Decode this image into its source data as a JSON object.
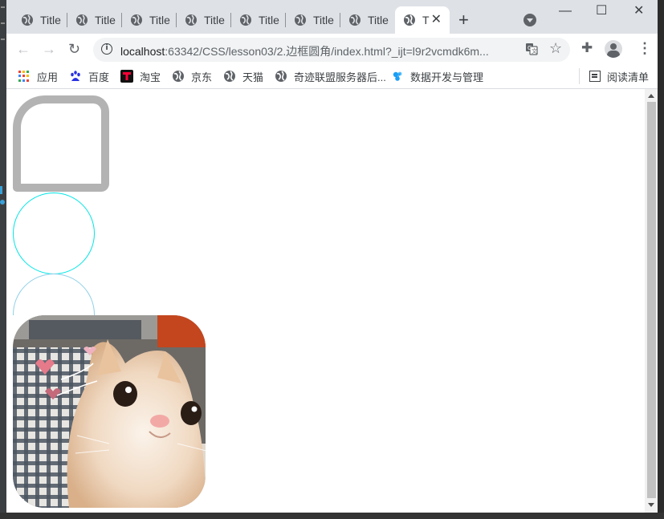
{
  "tabs": [
    {
      "label": "Title"
    },
    {
      "label": "Title"
    },
    {
      "label": "Title"
    },
    {
      "label": "Title"
    },
    {
      "label": "Title"
    },
    {
      "label": "Title"
    },
    {
      "label": "Title"
    },
    {
      "label": "T",
      "active": true
    }
  ],
  "tab_close_glyph": "✕",
  "new_tab_glyph": "+",
  "window_controls": {
    "minimize": "—",
    "maximize": "☐",
    "close": "✕"
  },
  "nav": {
    "back": "←",
    "forward": "→",
    "reload": "↻"
  },
  "omnibox": {
    "info_icon": "i",
    "url_host": "localhost",
    "url_path": ":63342/CSS/lesson03/2.边框圆角/index.html?_ijt=l9r2vcmdk6m...",
    "star": "☆"
  },
  "toolbar_icons": {
    "extensions": "✚",
    "menu": "⋮"
  },
  "bookmarks": [
    {
      "label": "应用",
      "icon": "apps-icon"
    },
    {
      "label": "百度",
      "icon": "baidu-icon"
    },
    {
      "label": "淘宝",
      "icon": "taobao-icon"
    },
    {
      "label": "京东",
      "icon": "globe-icon"
    },
    {
      "label": "天猫",
      "icon": "globe-icon"
    },
    {
      "label": "奇迹联盟服务器后...",
      "icon": "globe-icon"
    },
    {
      "label": "数据开发与管理",
      "icon": "data-icon"
    }
  ],
  "reading_list": {
    "label": "阅读清单",
    "icon": "reading-list-icon"
  },
  "colors": {
    "box_border": "#b3b3b3",
    "circle_border": "#00e5e5",
    "semicircle_border": "#8fd0e8",
    "tab_bar": "#dee1e6"
  },
  "page": {
    "demo_items": [
      "rounded-border-box",
      "circle",
      "semicircle",
      "rounded-cat-image"
    ]
  }
}
